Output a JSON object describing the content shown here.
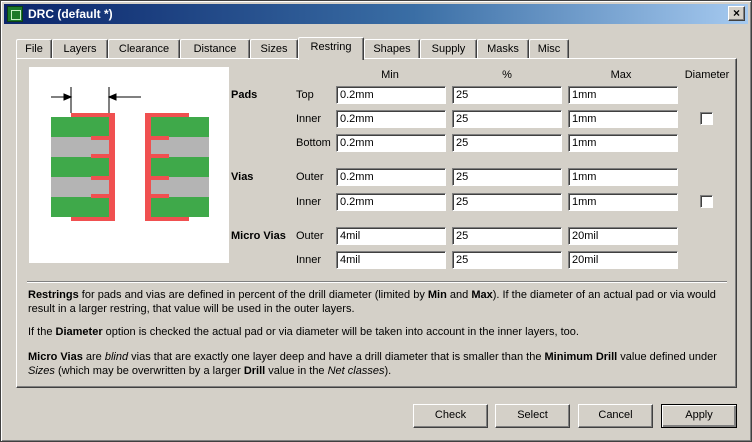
{
  "window": {
    "title": "DRC (default *)",
    "close_label": "×"
  },
  "tabs": [
    {
      "label": "File"
    },
    {
      "label": "Layers"
    },
    {
      "label": "Clearance"
    },
    {
      "label": "Distance"
    },
    {
      "label": "Sizes"
    },
    {
      "label": "Restring"
    },
    {
      "label": "Shapes"
    },
    {
      "label": "Supply"
    },
    {
      "label": "Masks"
    },
    {
      "label": "Misc"
    }
  ],
  "active_tab": "Restring",
  "columns": {
    "min": "Min",
    "pct": "%",
    "max": "Max",
    "diameter": "Diameter"
  },
  "pads": {
    "label": "Pads",
    "rows": [
      {
        "label": "Top",
        "min": "0.2mm",
        "pct": "25",
        "max": "1mm"
      },
      {
        "label": "Inner",
        "min": "0.2mm",
        "pct": "25",
        "max": "1mm"
      },
      {
        "label": "Bottom",
        "min": "0.2mm",
        "pct": "25",
        "max": "1mm"
      }
    ],
    "diameter_checked": false
  },
  "vias": {
    "label": "Vias",
    "rows": [
      {
        "label": "Outer",
        "min": "0.2mm",
        "pct": "25",
        "max": "1mm"
      },
      {
        "label": "Inner",
        "min": "0.2mm",
        "pct": "25",
        "max": "1mm"
      }
    ],
    "diameter_checked": false
  },
  "micro_vias": {
    "label": "Micro Vias",
    "rows": [
      {
        "label": "Outer",
        "min": "4mil",
        "pct": "25",
        "max": "20mil"
      },
      {
        "label": "Inner",
        "min": "4mil",
        "pct": "25",
        "max": "20mil"
      }
    ]
  },
  "description": {
    "p1": {
      "b1": "Restrings",
      "t1": " for pads and vias are defined in percent of the drill diameter (limited by ",
      "b2": "Min",
      "t2": " and ",
      "b3": "Max",
      "t3": "). If the diameter of an actual pad or via would result in a larger restring, that value will be used in the outer layers."
    },
    "p2": {
      "t1": "If the ",
      "b1": "Diameter",
      "t2": " option is checked the actual pad or via diameter will be taken into account in the inner layers, too."
    },
    "p3": {
      "b1": "Micro Vias",
      "t1": " are ",
      "i1": "blind",
      "t2": " vias that are exactly one layer deep and have a drill diameter that is smaller than the ",
      "b2": "Minimum Drill",
      "t3": " value defined under ",
      "i2": "Sizes",
      "t4": " (which may be overwritten by a larger ",
      "b3": "Drill",
      "t5": " value in the ",
      "i3": "Net classes",
      "t6": ")."
    }
  },
  "buttons": {
    "check": "Check",
    "select": "Select",
    "cancel": "Cancel",
    "apply": "Apply"
  },
  "colors": {
    "board": "#3fa94a",
    "core": "#b4b4b4",
    "copper": "#f05050"
  }
}
